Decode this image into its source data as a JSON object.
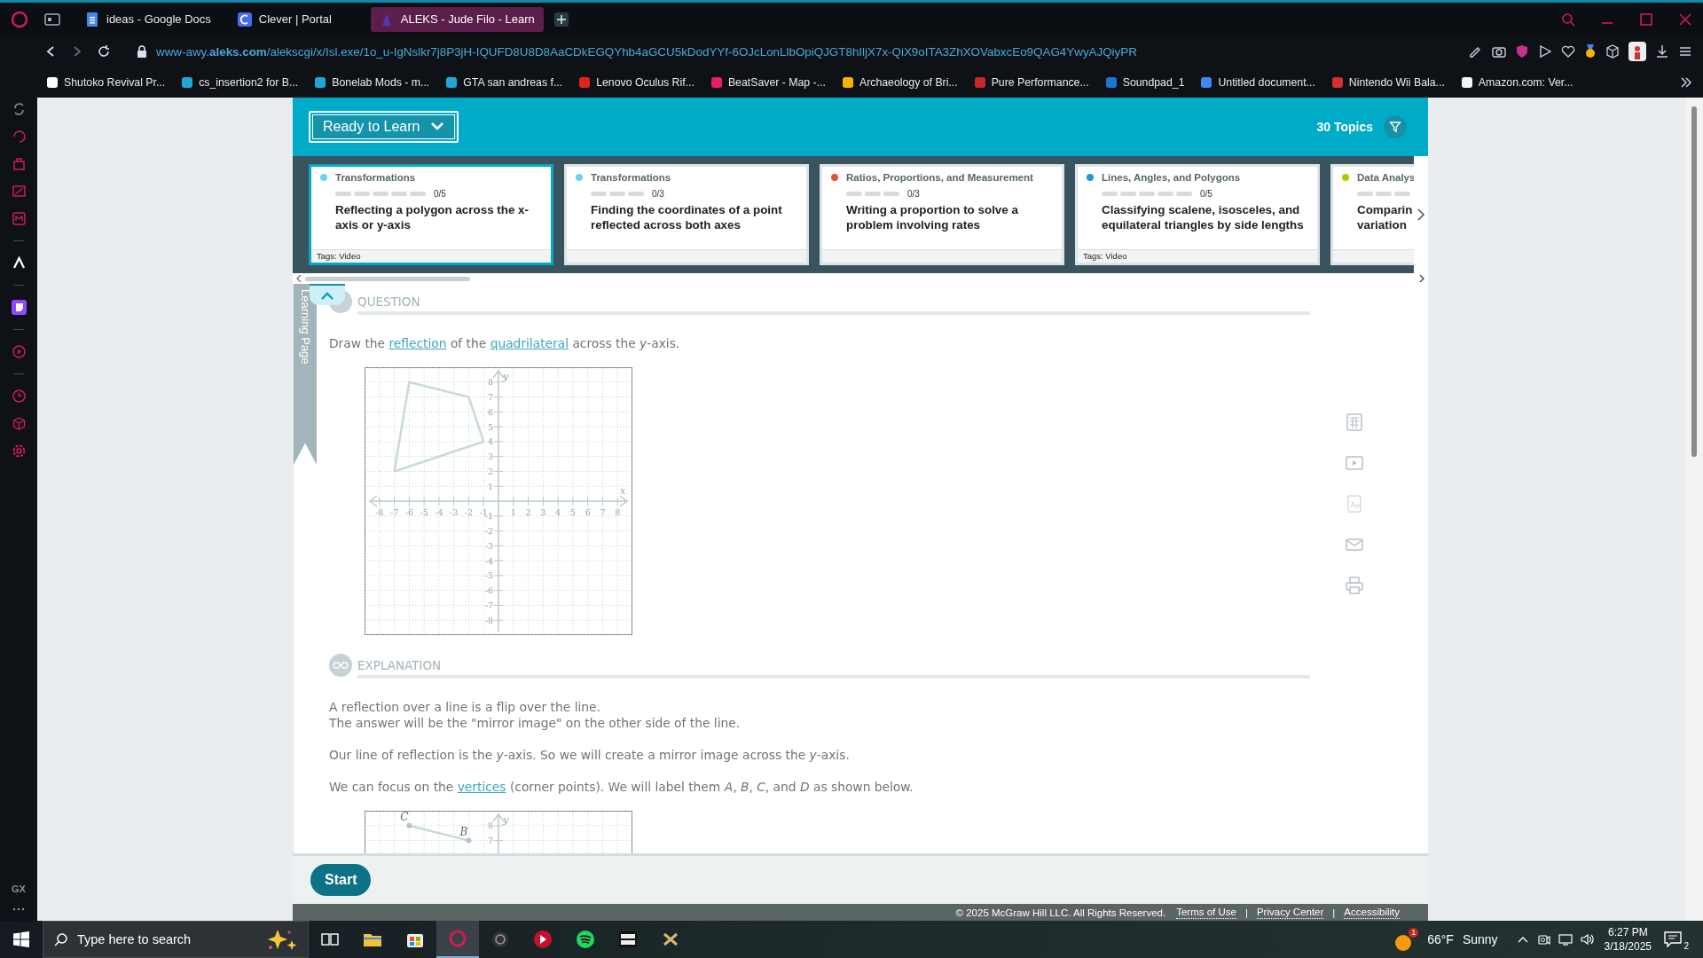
{
  "browser": {
    "tabs": [
      {
        "label": "ideas - Google Docs",
        "selected": false
      },
      {
        "label": "Clever | Portal",
        "selected": false
      },
      {
        "label": "ALEKS - Jude Filo - Learn",
        "selected": true
      }
    ],
    "address": "www-awy.**aleks.com**/alekscgi/x/Isl.exe/1o_u-IgNslkr7j8P3jH-IQUFD8U8D8AaCDkEGQYhb4aGCU5kDodYYf-6OJcLonLlbOpiQJGT8hIljX7x-QiX9oITA3ZhXOVabxcEo9QAG4YwyAJQiyPR",
    "bookmarks": [
      {
        "label": "Shutoko Revival Pr...",
        "color": "#ffffff"
      },
      {
        "label": "cs_insertion2 for B...",
        "color": "#1ea7d8"
      },
      {
        "label": "Bonelab Mods - m...",
        "color": "#1ea7d8"
      },
      {
        "label": "GTA san andreas f...",
        "color": "#1ea7d8"
      },
      {
        "label": "Lenovo Oculus Rif...",
        "color": "#e2231a"
      },
      {
        "label": "BeatSaver - Map -...",
        "color": "#e91e63"
      },
      {
        "label": "Archaeology of Bri...",
        "color": "#f4b400"
      },
      {
        "label": "Pure Performance...",
        "color": "#c62828"
      },
      {
        "label": "Soundpad_1",
        "color": "#1976d2"
      },
      {
        "label": "Untitled document...",
        "color": "#4285f4"
      },
      {
        "label": "Nintendo Wii Bala...",
        "color": "#d32f2f"
      },
      {
        "label": "Amazon.com: Ver...",
        "color": "#f5f5f5"
      }
    ],
    "sidebar_label": "GX"
  },
  "header": {
    "dropdown": "Ready to Learn",
    "topics": "30 Topics"
  },
  "cards": [
    {
      "category": "Transformations",
      "color": "#6fd3ec",
      "segments": [
        false,
        false,
        false,
        false,
        false
      ],
      "progress": "0/5",
      "title": "Reflecting a polygon across the x-axis or y-axis",
      "tags": "Tags: Video",
      "selected": true
    },
    {
      "category": "Transformations",
      "color": "#6fd3ec",
      "segments": [
        false,
        false,
        false
      ],
      "progress": "0/3",
      "title": "Finding the coordinates of a point reflected across both axes",
      "selected": false
    },
    {
      "category": "Ratios, Proportions, and Measurement",
      "color": "#e8512f",
      "segments": [
        false,
        false,
        false
      ],
      "progress": "0/3",
      "title": "Writing a proportion to solve a problem involving rates",
      "selected": false
    },
    {
      "category": "Lines, Angles, and Polygons",
      "color": "#1c9ad6",
      "segments": [
        false,
        false,
        false,
        false,
        false
      ],
      "progress": "0/5",
      "title": "Classifying scalene, isosceles, and equilateral triangles by side lengths",
      "tags": "Tags: Video",
      "selected": false
    },
    {
      "category": "Data Analys",
      "color": "#b5c800",
      "segments": [
        false,
        false,
        false
      ],
      "title": "Comparin\nvariation",
      "selected": false
    }
  ],
  "side_tab": "Learning Page",
  "question": {
    "heading": "QUESTION",
    "parts": [
      {
        "kind": "text",
        "text": "Draw the "
      },
      {
        "kind": "link",
        "text": "reflection"
      },
      {
        "kind": "text",
        "text": " of the "
      },
      {
        "kind": "link",
        "text": "quadrilateral"
      },
      {
        "kind": "text",
        "text": " across the *y*-axis."
      }
    ],
    "chart_data": {
      "type": "line",
      "grid": true,
      "xlabel": "x",
      "ylabel": "y",
      "xlim": [
        -9,
        9
      ],
      "ylim": [
        -9,
        9
      ],
      "xticks": [
        -8,
        -7,
        -6,
        -5,
        -4,
        -3,
        -2,
        -1,
        1,
        2,
        3,
        4,
        5,
        6,
        7,
        8
      ],
      "yticks": [
        8,
        7,
        6,
        5,
        4,
        3,
        2,
        1,
        -1,
        -2,
        -3,
        -4,
        -5,
        -6,
        -7,
        -8
      ],
      "x": [
        -7,
        -6,
        -2,
        -1
      ],
      "series": [
        {
          "color": "#c9d8dc",
          "values": [
            2,
            8,
            7,
            4
          ]
        },
        {
          "color": "#c9d8dc",
          "x": [
            -7,
            -1
          ],
          "values": [
            2,
            4
          ]
        }
      ]
    }
  },
  "explanation": {
    "heading": "EXPLANATION",
    "paragraphs": [
      [
        {
          "kind": "text",
          "text": "A reflection over a line is a flip over the line.\nThe answer will be the \"mirror image\" on the other side of the line."
        }
      ],
      [
        {
          "kind": "text",
          "text": "Our line of reflection is the *y*-axis. So we will create a mirror image across the *y*-axis."
        }
      ],
      [
        {
          "kind": "text",
          "text": "We can focus on the "
        },
        {
          "kind": "link",
          "text": "vertices"
        },
        {
          "kind": "text",
          "text": " (corner points). We will label them *A*, *B*, *C*, and *D* as shown below."
        }
      ]
    ],
    "chart_data": {
      "type": "line",
      "grid": true,
      "ylabel": "y",
      "xlim": [
        -9,
        9
      ],
      "ylim": [
        -9,
        9
      ],
      "yticks": [
        8,
        7
      ],
      "x": [
        -6,
        -2
      ],
      "series": [
        {
          "color": "#c9d8dc",
          "marker": "circle",
          "values": [
            8,
            7
          ]
        }
      ],
      "annotations": [
        {
          "x": -6,
          "y": 8,
          "text": "C"
        },
        {
          "x": -2,
          "y": 7,
          "text": "B"
        }
      ]
    }
  },
  "start_button": "Start",
  "footer": {
    "copyright": "© 2025 McGraw Hill LLC. All Rights Reserved.",
    "links": [
      "Terms of Use",
      "Privacy Center",
      "Accessibility"
    ],
    "separators": [
      "|",
      "|"
    ]
  },
  "taskbar": {
    "search_placeholder": "Type here to search",
    "weather_badge": "1",
    "temperature": "66°F",
    "condition": "Sunny",
    "time": "6:27 PM",
    "date": "3/18/2025",
    "notifications": "2"
  }
}
